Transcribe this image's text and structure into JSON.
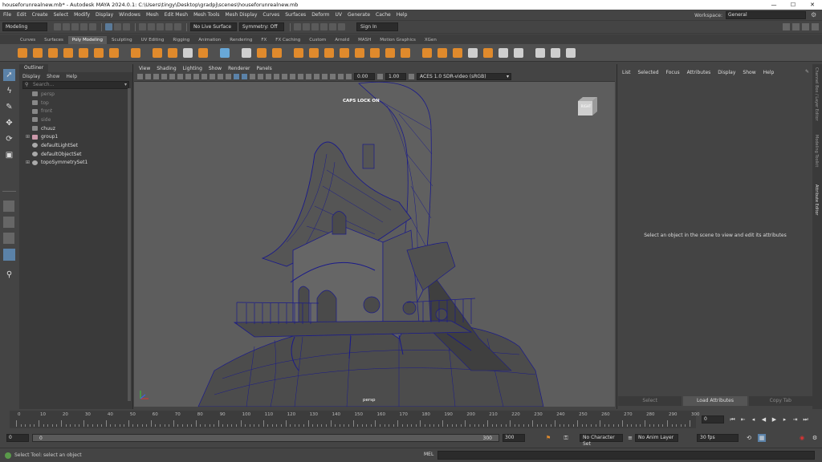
{
  "titlebar": {
    "title": "houseforunrealnew.mb* - Autodesk MAYA 2024.0.1: C:\\Users\\tingy\\Desktop\\gradpj\\scenes\\houseforunrealnew.mb",
    "minimize": "—",
    "maximize": "☐",
    "close": "✕"
  },
  "menubar": {
    "items": [
      "File",
      "Edit",
      "Create",
      "Select",
      "Modify",
      "Display",
      "Windows",
      "Mesh",
      "Edit Mesh",
      "Mesh Tools",
      "Mesh Display",
      "Curves",
      "Surfaces",
      "Deform",
      "UV",
      "Generate",
      "Cache",
      "Help"
    ],
    "workspace_label": "Workspace:",
    "workspace_value": "General"
  },
  "statusline": {
    "mode": "Modeling",
    "live_surface": "No Live Surface",
    "symmetry": "Symmetry: Off",
    "sign_in": "Sign In"
  },
  "shelf": {
    "tabs": [
      "Curves",
      "Surfaces",
      "Poly Modeling",
      "Sculpting",
      "UV Editing",
      "Rigging",
      "Animation",
      "Rendering",
      "FX",
      "FX Caching",
      "Custom",
      "Arnold",
      "MASH",
      "Motion Graphics",
      "XGen"
    ],
    "active_tab": "Poly Modeling"
  },
  "outliner": {
    "title": "Outliner",
    "menu": [
      "Display",
      "Show",
      "Help"
    ],
    "search_placeholder": "Search...",
    "items": [
      {
        "label": "persp",
        "dim": true,
        "expandable": false,
        "icon": "camera"
      },
      {
        "label": "top",
        "dim": true,
        "expandable": false,
        "icon": "camera"
      },
      {
        "label": "front",
        "dim": true,
        "expandable": false,
        "icon": "camera"
      },
      {
        "label": "side",
        "dim": true,
        "expandable": false,
        "icon": "camera"
      },
      {
        "label": "chuuz",
        "dim": false,
        "expandable": false,
        "icon": "joint"
      },
      {
        "label": "group1",
        "dim": false,
        "expandable": true,
        "icon": "group"
      },
      {
        "label": "defaultLightSet",
        "dim": false,
        "expandable": false,
        "icon": "set"
      },
      {
        "label": "defaultObjectSet",
        "dim": false,
        "expandable": false,
        "icon": "set"
      },
      {
        "label": "topoSymmetrySet1",
        "dim": false,
        "expandable": true,
        "icon": "set"
      }
    ]
  },
  "viewport": {
    "menu": [
      "View",
      "Shading",
      "Lighting",
      "Show",
      "Renderer",
      "Panels"
    ],
    "exposure": "0.00",
    "gamma": "1.00",
    "colorspace": "ACES 1.0 SDR-video (sRGB)",
    "caps_lock": "CAPS LOCK ON",
    "camera": "persp",
    "viewcube_face": "RIGHT"
  },
  "attribute_editor": {
    "menu": [
      "List",
      "Selected",
      "Focus",
      "Attributes",
      "Display",
      "Show",
      "Help"
    ],
    "message": "Select an object in the scene to view and edit its attributes",
    "buttons": [
      "Select",
      "Load Attributes",
      "Copy Tab"
    ],
    "side_tabs": [
      "Channel Box / Layer Editor",
      "Modeling Toolkit",
      "Attribute Editor"
    ]
  },
  "timeline": {
    "ticks": [
      "0",
      "10",
      "20",
      "30",
      "40",
      "50",
      "60",
      "70",
      "80",
      "90",
      "100",
      "110",
      "120",
      "130",
      "140",
      "150",
      "160",
      "170",
      "180",
      "190",
      "200",
      "210",
      "220",
      "230",
      "240",
      "250",
      "260",
      "270",
      "280",
      "290",
      "300"
    ],
    "current_frame": "0"
  },
  "range": {
    "start": "0",
    "inner_start": "0",
    "inner_end": "300",
    "end_field": "300",
    "end_field2": "300",
    "character_set": "No Character Set",
    "anim_layer": "No Anim Layer",
    "fps": "30 fps"
  },
  "helpline": {
    "message": "Select Tool: select an object",
    "mel_label": "MEL"
  },
  "colors": {
    "accent": "#5b82a8",
    "shelf_orange": "#e08a2c",
    "wireframe": "#1a1a8a",
    "maya_blue": "#0696d7"
  }
}
